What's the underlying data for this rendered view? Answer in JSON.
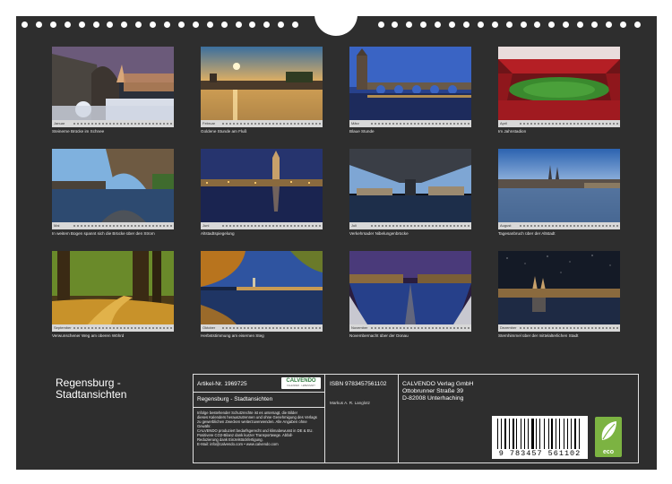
{
  "calendar_title": "Regensburg -\nStadtansichten",
  "months": [
    {
      "label": "Januar",
      "caption": "Steinerne Brücke im Schnee",
      "scene": "snow"
    },
    {
      "label": "Februar",
      "caption": "Goldene Stunde am Fluß",
      "scene": "golden"
    },
    {
      "label": "März",
      "caption": "Blaue Stunde",
      "scene": "bluehour"
    },
    {
      "label": "April",
      "caption": "Im Jahnstadion",
      "scene": "stadium"
    },
    {
      "label": "Mai",
      "caption": "In weitem Bogen spannt sich die Brücke über den Strom",
      "scene": "arch"
    },
    {
      "label": "Juni",
      "caption": "Altstadtspiegelung",
      "scene": "reflection"
    },
    {
      "label": "Juli",
      "caption": "Verkehrsader Nibelungenbrücke",
      "scene": "underbridge"
    },
    {
      "label": "August",
      "caption": "Tagesanbruch über der Altstadt",
      "scene": "dawn"
    },
    {
      "label": "September",
      "caption": "Verwunschener Weg am oberen Wöhrd",
      "scene": "forest"
    },
    {
      "label": "Oktober",
      "caption": "Herbststimmung am eisernen Steg",
      "scene": "autumn"
    },
    {
      "label": "November",
      "caption": "Novembernacht über der Donau",
      "scene": "november"
    },
    {
      "label": "Dezember",
      "caption": "Sternhimmel über der mittelalterlichen Stadt",
      "scene": "stars"
    }
  ],
  "info": {
    "article": "Artikel-Nr. 1969725",
    "logo": "CALVENDO",
    "logo_sub": "KALENDER · LEBENSART",
    "product_title": "Regensburg - Stadtansichten",
    "isbn": "ISBN 9783457561102",
    "author": "Markus A. R. Langlotz",
    "publisher_1": "CALVENDO Verlag GmbH",
    "publisher_2": "Ottobrunner Straße 39",
    "publisher_3": "D-82008 Unterhaching",
    "legal": [
      "Infolge bestehender Schutzrechte ist es untersagt, die Bilder",
      "dieses Kalenders herauszutrennen und ohne Genehmigung des Verlags",
      "zu gewerblichen Zwecken weiterzuverwenden. Alle Angaben ohne",
      "Gewähr.",
      "CALVENDO produziert bedarfsgerecht und klimabewusst in DE & EU.",
      "Positivere CO2-Bilanz dank kurzer Transportwege. Abfall-",
      "Reduzierung dank Einzelstückfertigung.",
      "E-Mail: info@calvendo.com • www.calvendo.com"
    ],
    "barcode_number": "9 783457 561102",
    "eco_label": "eco"
  }
}
